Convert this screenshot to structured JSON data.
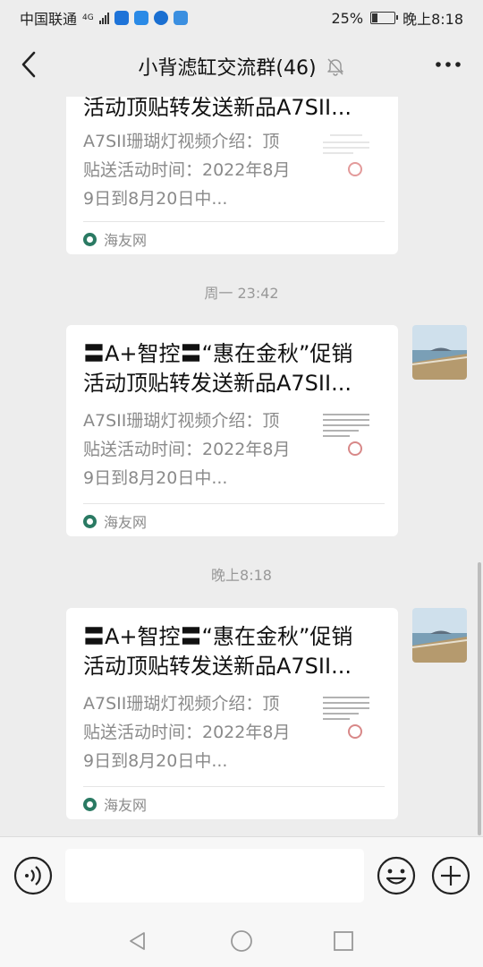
{
  "status_bar": {
    "carrier": "中国联通",
    "network": "4G",
    "battery": "25%",
    "battery_level": 0.25,
    "time": "晚上8:18"
  },
  "header": {
    "title": "小背滤缸交流群(46)",
    "icons": [
      "back-arrow-icon",
      "mute-bell-icon",
      "more-dots-icon"
    ]
  },
  "messages": [
    {
      "title": "活动顶贴转发送新品A7SII...",
      "description": "A7SII珊瑚灯视频介绍：顶贴送活动时间：2022年8月9日到8月20日中...",
      "source": "海友网"
    },
    {
      "timestamp": "周一 23:42",
      "title": "〓A+智控〓“惠在金秋”促销活动顶贴转发送新品A7SII...",
      "description": "A7SII珊瑚灯视频介绍：顶贴送活动时间：2022年8月9日到8月20日中...",
      "source": "海友网"
    },
    {
      "timestamp": "晚上8:18",
      "title": "〓A+智控〓“惠在金秋”促销活动顶贴转发送新品A7SII...",
      "description": "A7SII珊瑚灯视频介绍：顶贴送活动时间：2022年8月9日到8月20日中...",
      "source": "海友网"
    }
  ],
  "colors": {
    "background": "#ededed",
    "card": "#ffffff",
    "secondary_text": "#8a8a8a",
    "source_icon": "#2a7a63"
  }
}
